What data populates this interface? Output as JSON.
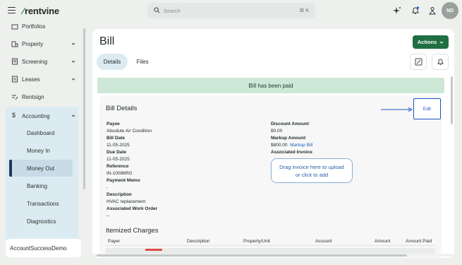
{
  "app": {
    "logo": "rentvine"
  },
  "search": {
    "placeholder": "Search",
    "shortcut": "⌘ K"
  },
  "user": {
    "initials": "ND"
  },
  "sidebar": {
    "partial_top": "Portfolios",
    "items": [
      {
        "label": "Property",
        "icon": "building-icon"
      },
      {
        "label": "Screening",
        "icon": "screening-icon"
      },
      {
        "label": "Leases",
        "icon": "lease-icon"
      },
      {
        "label": "Rentsign",
        "icon": "sign-icon"
      },
      {
        "label": "Accounting",
        "icon": "dollar-icon"
      }
    ],
    "accounting_sub": [
      "Dashboard",
      "Money In",
      "Money Out",
      "Banking",
      "Transactions",
      "Diagnostics"
    ],
    "active_sub": "Money Out",
    "account_name": "AccountSuccessDemo"
  },
  "page": {
    "title": "Bill",
    "actions_label": "Actions",
    "tabs": [
      "Details",
      "Files"
    ],
    "banner": "Bill has been paid"
  },
  "bill_details": {
    "heading": "Bill Details",
    "edit_label": "Edit",
    "left": [
      {
        "label": "Payee",
        "value": "Absolute Air Condition"
      },
      {
        "label": "Bill Date",
        "value": "11-05-2025"
      },
      {
        "label": "Due Date",
        "value": "11-05-2025"
      },
      {
        "label": "Reference",
        "value": "IN-10086RG"
      },
      {
        "label": "Payment Memo",
        "value": "-"
      },
      {
        "label": "Description",
        "value": "HVAC replacement"
      },
      {
        "label": "Associated Work Order",
        "value": "--"
      }
    ],
    "right": {
      "discount_label": "Discount Amount",
      "discount_value": "$0.00",
      "markup_label": "Markup Amount",
      "markup_value": "$800.00",
      "markup_link": "Markup Bill",
      "invoice_label": "Associated Invoice",
      "upload_line1": "Drag invoice here to upload",
      "upload_line2": "or click to add"
    }
  },
  "itemized": {
    "heading": "Itemized Charges",
    "columns": [
      "Payer",
      "Description",
      "Property/Unit",
      "Account",
      "Amount",
      "Amount Paid"
    ]
  },
  "colors": {
    "brand": "#2e7d4f",
    "actions": "#1f6f43",
    "banner": "#cde8d6",
    "highlight": "#1d4fc4"
  }
}
